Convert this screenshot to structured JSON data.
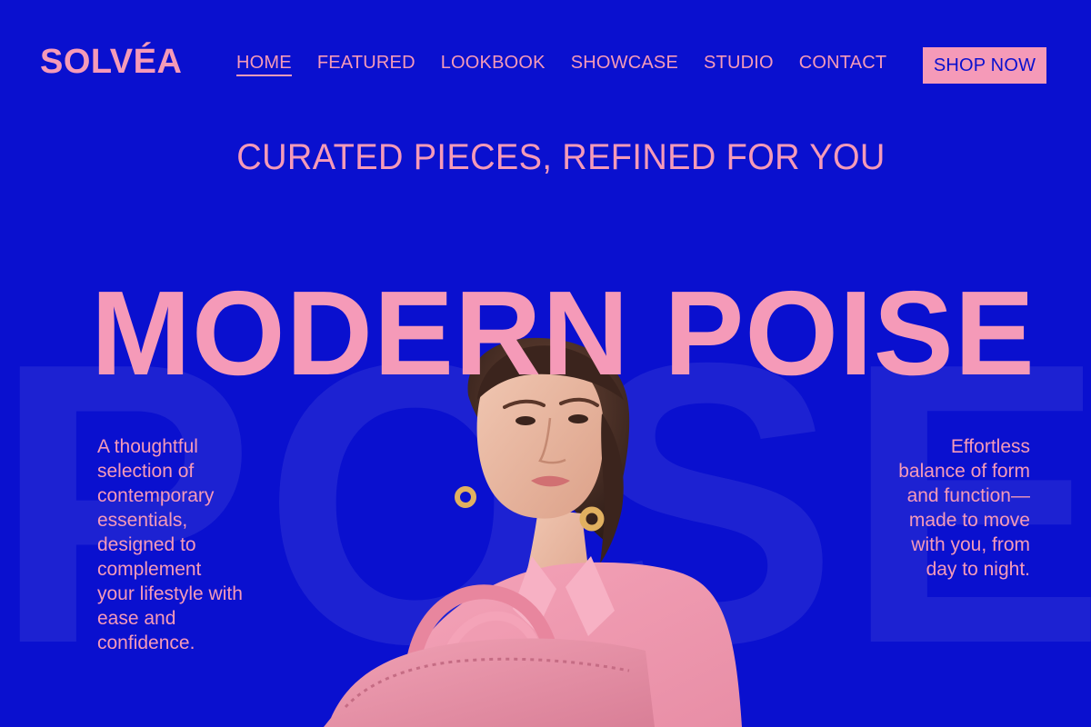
{
  "brand": "SOLVÉA",
  "nav": {
    "items": [
      "HOME",
      "FEATURED",
      "LOOKBOOK",
      "SHOWCASE",
      "STUDIO",
      "CONTACT"
    ],
    "active_index": 0
  },
  "cta": {
    "label": "SHOP NOW"
  },
  "hero": {
    "subheading": "CURATED PIECES, REFINED FOR YOU",
    "title": "MODERN POISE",
    "watermark": [
      "P",
      "O",
      "S",
      "E"
    ]
  },
  "left_text": "A thoughtful selection of contemporary essentials, designed to complement your lifestyle with ease and confidence.",
  "right_text": "Effortless balance of form and function—made to move with you, from day to night.",
  "colors": {
    "background": "#0a10cf",
    "accent": "#f59ab8"
  }
}
